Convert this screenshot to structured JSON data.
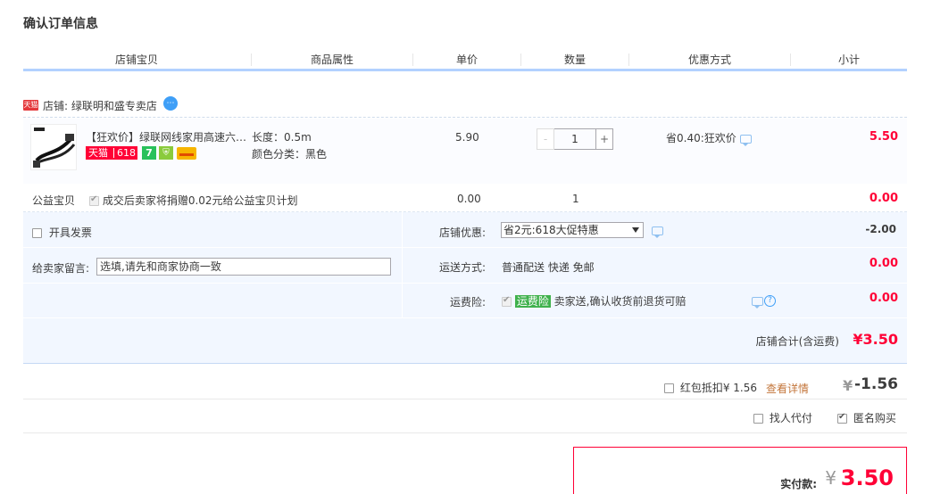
{
  "page_title": "确认订单信息",
  "columns": [
    "店铺宝贝",
    "商品属性",
    "单价",
    "数量",
    "优惠方式",
    "小计"
  ],
  "shop": {
    "badge": "天猫",
    "label": "店铺: 绿联明和盛专卖店"
  },
  "item": {
    "title": "【狂欢价】绿联网线家用高速六…",
    "badge_tmall": "天猫",
    "badge_618": "618",
    "badge_7": "7",
    "length": "长度：0.5m",
    "color": "颜色分类：黑色",
    "price": "5.90",
    "quantity": "1",
    "minus": "-",
    "plus": "+",
    "promo": "省0.40:狂欢价",
    "subtotal": "5.50"
  },
  "charity": {
    "label": "公益宝贝",
    "text": "成交后卖家将捐赠0.02元给公益宝贝计划",
    "price": "0.00",
    "quantity": "1",
    "subtotal": "0.00"
  },
  "options": {
    "invoice_label": "开具发票",
    "shop_discount_label": "店铺优惠:",
    "shop_discount_value": "省2元:618大促特惠",
    "shop_discount_amount": "-2.00",
    "message_label": "给卖家留言:",
    "message_placeholder": "选填,请先和商家协商一致",
    "shipping_label": "运送方式:",
    "shipping_value": "普通配送 快递 免邮",
    "shipping_amount": "0.00",
    "insurance_label": "运费险:",
    "insurance_badge": "运费险",
    "insurance_text": "卖家送,确认收货前退货可赔",
    "insurance_amount": "0.00",
    "shop_total_label": "店铺合计(含运费)",
    "shop_total_value": "¥3.50"
  },
  "redpacket": {
    "label": "红包抵扣¥ 1.56",
    "link": "查看详情",
    "yen": "¥",
    "amount": "-1.56"
  },
  "agent": {
    "proxy_label": "找人代付",
    "anonymous_label": "匿名购买"
  },
  "payment": {
    "label": "实付款:",
    "yen": "¥",
    "amount": "3.50"
  },
  "colors": {
    "accent_red": "#ff0036",
    "header_line": "#b2d1ff",
    "options_bg": "#f2f7ff"
  }
}
